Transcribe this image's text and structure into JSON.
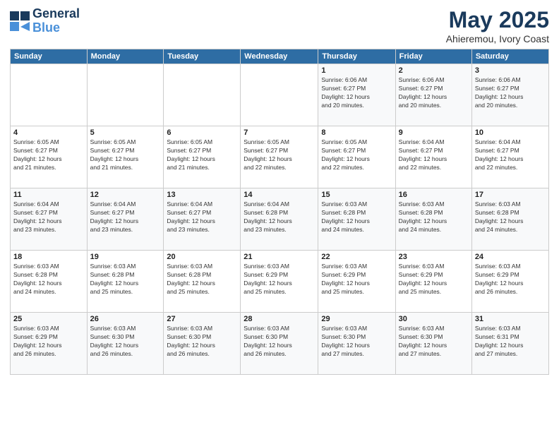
{
  "logo": {
    "line1": "General",
    "line2": "Blue"
  },
  "title": "May 2025",
  "subtitle": "Ahieremou, Ivory Coast",
  "days_of_week": [
    "Sunday",
    "Monday",
    "Tuesday",
    "Wednesday",
    "Thursday",
    "Friday",
    "Saturday"
  ],
  "weeks": [
    [
      {
        "day": "",
        "detail": ""
      },
      {
        "day": "",
        "detail": ""
      },
      {
        "day": "",
        "detail": ""
      },
      {
        "day": "",
        "detail": ""
      },
      {
        "day": "1",
        "detail": "Sunrise: 6:06 AM\nSunset: 6:27 PM\nDaylight: 12 hours\nand 20 minutes."
      },
      {
        "day": "2",
        "detail": "Sunrise: 6:06 AM\nSunset: 6:27 PM\nDaylight: 12 hours\nand 20 minutes."
      },
      {
        "day": "3",
        "detail": "Sunrise: 6:06 AM\nSunset: 6:27 PM\nDaylight: 12 hours\nand 20 minutes."
      }
    ],
    [
      {
        "day": "4",
        "detail": "Sunrise: 6:05 AM\nSunset: 6:27 PM\nDaylight: 12 hours\nand 21 minutes."
      },
      {
        "day": "5",
        "detail": "Sunrise: 6:05 AM\nSunset: 6:27 PM\nDaylight: 12 hours\nand 21 minutes."
      },
      {
        "day": "6",
        "detail": "Sunrise: 6:05 AM\nSunset: 6:27 PM\nDaylight: 12 hours\nand 21 minutes."
      },
      {
        "day": "7",
        "detail": "Sunrise: 6:05 AM\nSunset: 6:27 PM\nDaylight: 12 hours\nand 22 minutes."
      },
      {
        "day": "8",
        "detail": "Sunrise: 6:05 AM\nSunset: 6:27 PM\nDaylight: 12 hours\nand 22 minutes."
      },
      {
        "day": "9",
        "detail": "Sunrise: 6:04 AM\nSunset: 6:27 PM\nDaylight: 12 hours\nand 22 minutes."
      },
      {
        "day": "10",
        "detail": "Sunrise: 6:04 AM\nSunset: 6:27 PM\nDaylight: 12 hours\nand 22 minutes."
      }
    ],
    [
      {
        "day": "11",
        "detail": "Sunrise: 6:04 AM\nSunset: 6:27 PM\nDaylight: 12 hours\nand 23 minutes."
      },
      {
        "day": "12",
        "detail": "Sunrise: 6:04 AM\nSunset: 6:27 PM\nDaylight: 12 hours\nand 23 minutes."
      },
      {
        "day": "13",
        "detail": "Sunrise: 6:04 AM\nSunset: 6:27 PM\nDaylight: 12 hours\nand 23 minutes."
      },
      {
        "day": "14",
        "detail": "Sunrise: 6:04 AM\nSunset: 6:28 PM\nDaylight: 12 hours\nand 23 minutes."
      },
      {
        "day": "15",
        "detail": "Sunrise: 6:03 AM\nSunset: 6:28 PM\nDaylight: 12 hours\nand 24 minutes."
      },
      {
        "day": "16",
        "detail": "Sunrise: 6:03 AM\nSunset: 6:28 PM\nDaylight: 12 hours\nand 24 minutes."
      },
      {
        "day": "17",
        "detail": "Sunrise: 6:03 AM\nSunset: 6:28 PM\nDaylight: 12 hours\nand 24 minutes."
      }
    ],
    [
      {
        "day": "18",
        "detail": "Sunrise: 6:03 AM\nSunset: 6:28 PM\nDaylight: 12 hours\nand 24 minutes."
      },
      {
        "day": "19",
        "detail": "Sunrise: 6:03 AM\nSunset: 6:28 PM\nDaylight: 12 hours\nand 25 minutes."
      },
      {
        "day": "20",
        "detail": "Sunrise: 6:03 AM\nSunset: 6:28 PM\nDaylight: 12 hours\nand 25 minutes."
      },
      {
        "day": "21",
        "detail": "Sunrise: 6:03 AM\nSunset: 6:29 PM\nDaylight: 12 hours\nand 25 minutes."
      },
      {
        "day": "22",
        "detail": "Sunrise: 6:03 AM\nSunset: 6:29 PM\nDaylight: 12 hours\nand 25 minutes."
      },
      {
        "day": "23",
        "detail": "Sunrise: 6:03 AM\nSunset: 6:29 PM\nDaylight: 12 hours\nand 25 minutes."
      },
      {
        "day": "24",
        "detail": "Sunrise: 6:03 AM\nSunset: 6:29 PM\nDaylight: 12 hours\nand 26 minutes."
      }
    ],
    [
      {
        "day": "25",
        "detail": "Sunrise: 6:03 AM\nSunset: 6:29 PM\nDaylight: 12 hours\nand 26 minutes."
      },
      {
        "day": "26",
        "detail": "Sunrise: 6:03 AM\nSunset: 6:30 PM\nDaylight: 12 hours\nand 26 minutes."
      },
      {
        "day": "27",
        "detail": "Sunrise: 6:03 AM\nSunset: 6:30 PM\nDaylight: 12 hours\nand 26 minutes."
      },
      {
        "day": "28",
        "detail": "Sunrise: 6:03 AM\nSunset: 6:30 PM\nDaylight: 12 hours\nand 26 minutes."
      },
      {
        "day": "29",
        "detail": "Sunrise: 6:03 AM\nSunset: 6:30 PM\nDaylight: 12 hours\nand 27 minutes."
      },
      {
        "day": "30",
        "detail": "Sunrise: 6:03 AM\nSunset: 6:30 PM\nDaylight: 12 hours\nand 27 minutes."
      },
      {
        "day": "31",
        "detail": "Sunrise: 6:03 AM\nSunset: 6:31 PM\nDaylight: 12 hours\nand 27 minutes."
      }
    ]
  ]
}
